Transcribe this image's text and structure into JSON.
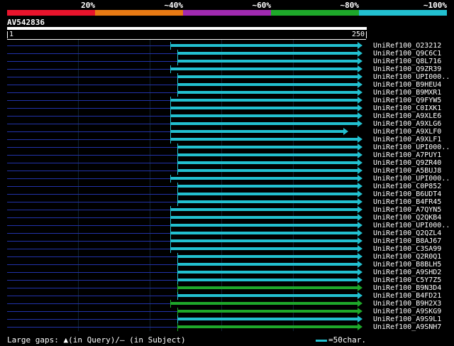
{
  "legend": {
    "colors": [
      "#e8142c",
      "#e87a14",
      "#a02ab0",
      "#1ea82a",
      "#22c0d0"
    ],
    "labels": [
      "20%",
      "~40%",
      "~60%",
      "~80%",
      "~100%"
    ]
  },
  "query": {
    "title": "AV542836",
    "start_label": "1",
    "end_label": "250"
  },
  "hits": [
    {
      "label": "UniRef100_O23212",
      "start": 0.46,
      "end": 1.0,
      "color": "#22c0d0"
    },
    {
      "label": "UniRef100_Q9C6C1",
      "start": 0.48,
      "end": 1.0,
      "color": "#22c0d0"
    },
    {
      "label": "UniRef100_Q8L716",
      "start": 0.48,
      "end": 1.0,
      "color": "#22c0d0"
    },
    {
      "label": "UniRef100_Q9ZR39",
      "start": 0.46,
      "end": 1.0,
      "color": "#22c0d0"
    },
    {
      "label": "UniRef100_UPI000..",
      "start": 0.48,
      "end": 1.0,
      "color": "#22c0d0"
    },
    {
      "label": "UniRef100_B9HEU4",
      "start": 0.48,
      "end": 1.0,
      "color": "#22c0d0"
    },
    {
      "label": "UniRef100_B9MXR1",
      "start": 0.48,
      "end": 1.0,
      "color": "#22c0d0"
    },
    {
      "label": "UniRef100_Q9FYW5",
      "start": 0.46,
      "end": 1.0,
      "color": "#22c0d0"
    },
    {
      "label": "UniRef100_C0IXK1",
      "start": 0.46,
      "end": 1.0,
      "color": "#22c0d0"
    },
    {
      "label": "UniRef100_A9XLE6",
      "start": 0.46,
      "end": 1.0,
      "color": "#22c0d0"
    },
    {
      "label": "UniRef100_A9XLG6",
      "start": 0.46,
      "end": 1.0,
      "color": "#22c0d0"
    },
    {
      "label": "UniRef100_A9XLF0",
      "start": 0.46,
      "end": 0.96,
      "color": "#22c0d0"
    },
    {
      "label": "UniRef100_A9XLF1",
      "start": 0.46,
      "end": 1.0,
      "color": "#22c0d0"
    },
    {
      "label": "UniRef100_UPI000..",
      "start": 0.48,
      "end": 1.0,
      "color": "#22c0d0"
    },
    {
      "label": "UniRef100_A7PUY1",
      "start": 0.48,
      "end": 1.0,
      "color": "#22c0d0"
    },
    {
      "label": "UniRef100_Q9ZR40",
      "start": 0.48,
      "end": 1.0,
      "color": "#22c0d0"
    },
    {
      "label": "UniRef100_A5BUJ8",
      "start": 0.48,
      "end": 1.0,
      "color": "#22c0d0"
    },
    {
      "label": "UniRef100_UPI000..",
      "start": 0.46,
      "end": 1.0,
      "color": "#22c0d0"
    },
    {
      "label": "UniRef100_C0P852",
      "start": 0.48,
      "end": 1.0,
      "color": "#22c0d0"
    },
    {
      "label": "UniRef100_B6UDT4",
      "start": 0.48,
      "end": 1.0,
      "color": "#22c0d0"
    },
    {
      "label": "UniRef100_B4FR45",
      "start": 0.48,
      "end": 1.0,
      "color": "#22c0d0"
    },
    {
      "label": "UniRef100_A7QYN5",
      "start": 0.46,
      "end": 1.0,
      "color": "#22c0d0"
    },
    {
      "label": "UniRef100_Q2QKB4",
      "start": 0.46,
      "end": 1.0,
      "color": "#22c0d0"
    },
    {
      "label": "UniRef100_UPI000..",
      "start": 0.46,
      "end": 1.0,
      "color": "#22c0d0"
    },
    {
      "label": "UniRef100_Q2QZL4",
      "start": 0.46,
      "end": 1.0,
      "color": "#22c0d0"
    },
    {
      "label": "UniRef100_B8AJ67",
      "start": 0.46,
      "end": 1.0,
      "color": "#22c0d0"
    },
    {
      "label": "UniRef100_C3SA99",
      "start": 0.46,
      "end": 1.0,
      "color": "#22c0d0"
    },
    {
      "label": "UniRef100_Q2R0Q1",
      "start": 0.48,
      "end": 1.0,
      "color": "#22c0d0"
    },
    {
      "label": "UniRef100_B8BLH5",
      "start": 0.48,
      "end": 1.0,
      "color": "#22c0d0"
    },
    {
      "label": "UniRef100_A9SHD2",
      "start": 0.48,
      "end": 1.0,
      "color": "#22c0d0"
    },
    {
      "label": "UniRef100_C5Y7Z5",
      "start": 0.48,
      "end": 1.0,
      "color": "#22c0d0"
    },
    {
      "label": "UniRef100_B9N3D4",
      "start": 0.48,
      "end": 1.0,
      "color": "#1ea82a"
    },
    {
      "label": "UniRef100_B4FD21",
      "start": 0.48,
      "end": 1.0,
      "color": "#22c0d0"
    },
    {
      "label": "UniRef100_B9H2X3",
      "start": 0.46,
      "end": 1.0,
      "color": "#1ea82a"
    },
    {
      "label": "UniRef100_A9SKG9",
      "start": 0.48,
      "end": 1.0,
      "color": "#1ea82a"
    },
    {
      "label": "UniRef100_A9S9L1",
      "start": 0.48,
      "end": 1.0,
      "color": "#22c0d0"
    },
    {
      "label": "UniRef100_A9SNH7",
      "start": 0.48,
      "end": 1.0,
      "color": "#1ea82a"
    }
  ],
  "footer": {
    "gaps_text": "Large gaps: ▲(in Query)/– (in Subject)",
    "scale_text": "=50char."
  }
}
